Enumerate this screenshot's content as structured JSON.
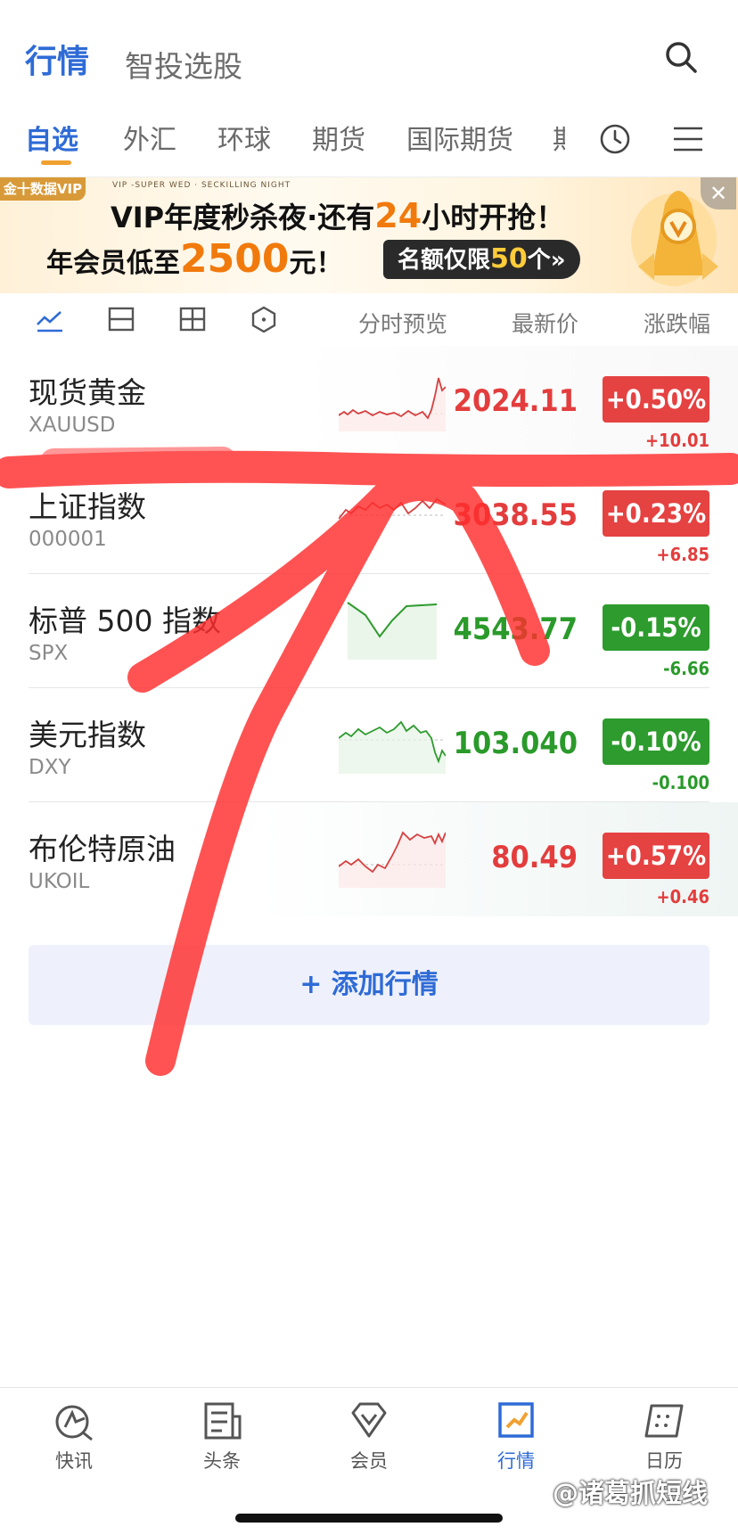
{
  "header": {
    "title": "行情",
    "subtitle": "智投选股",
    "search_icon": "search-icon"
  },
  "tabs": [
    {
      "label": "自选",
      "active": true
    },
    {
      "label": "外汇"
    },
    {
      "label": "环球"
    },
    {
      "label": "期货"
    },
    {
      "label": "国际期货"
    },
    {
      "label": "期"
    }
  ],
  "banner": {
    "badge": "金十数据VIP",
    "small_text": "VIP -SUPER WED · SECKILLING NIGHT",
    "line1_pre": "VIP年度秒杀夜·还有",
    "line1_hl": "24",
    "line1_post": "小时开抢！",
    "line2_pre": "年会员低至",
    "line2_big": "2500",
    "line2_post": "元！",
    "pill_pre": "名额仅限",
    "pill_hl": "50",
    "pill_post": "个»",
    "close": "✕"
  },
  "viewbar": {
    "col_chart": "分时预览",
    "col_price": "最新价",
    "col_change": "涨跌幅"
  },
  "quotes": [
    {
      "name": "现货黄金",
      "code": "XAUUSD",
      "price": "2024.11",
      "change_pct": "+0.50%",
      "change": "+10.01",
      "dir": "up"
    },
    {
      "name": "上证指数",
      "code": "000001",
      "price": "3038.55",
      "change_pct": "+0.23%",
      "change": "+6.85",
      "dir": "up"
    },
    {
      "name": "标普 500 指数",
      "code": "SPX",
      "price": "4543.77",
      "change_pct": "-0.15%",
      "change": "-6.66",
      "dir": "down"
    },
    {
      "name": "美元指数",
      "code": "DXY",
      "price": "103.040",
      "change_pct": "-0.10%",
      "change": "-0.100",
      "dir": "down"
    },
    {
      "name": "布伦特原油",
      "code": "UKOIL",
      "price": "80.49",
      "change_pct": "+0.57%",
      "change": "+0.46",
      "dir": "up"
    }
  ],
  "add_button": "+ 添加行情",
  "bottom_nav": [
    {
      "label": "快讯",
      "icon": "flash-news-icon"
    },
    {
      "label": "头条",
      "icon": "headline-icon"
    },
    {
      "label": "会员",
      "icon": "vip-diamond-icon"
    },
    {
      "label": "行情",
      "icon": "market-icon",
      "active": true
    },
    {
      "label": "日历",
      "icon": "calendar-icon"
    }
  ],
  "watermark": "@诸葛抓短线",
  "colors": {
    "accent": "#2f6bd6",
    "up": "#e54242",
    "down": "#2d9b2d",
    "tab_underline": "#f1a131"
  }
}
